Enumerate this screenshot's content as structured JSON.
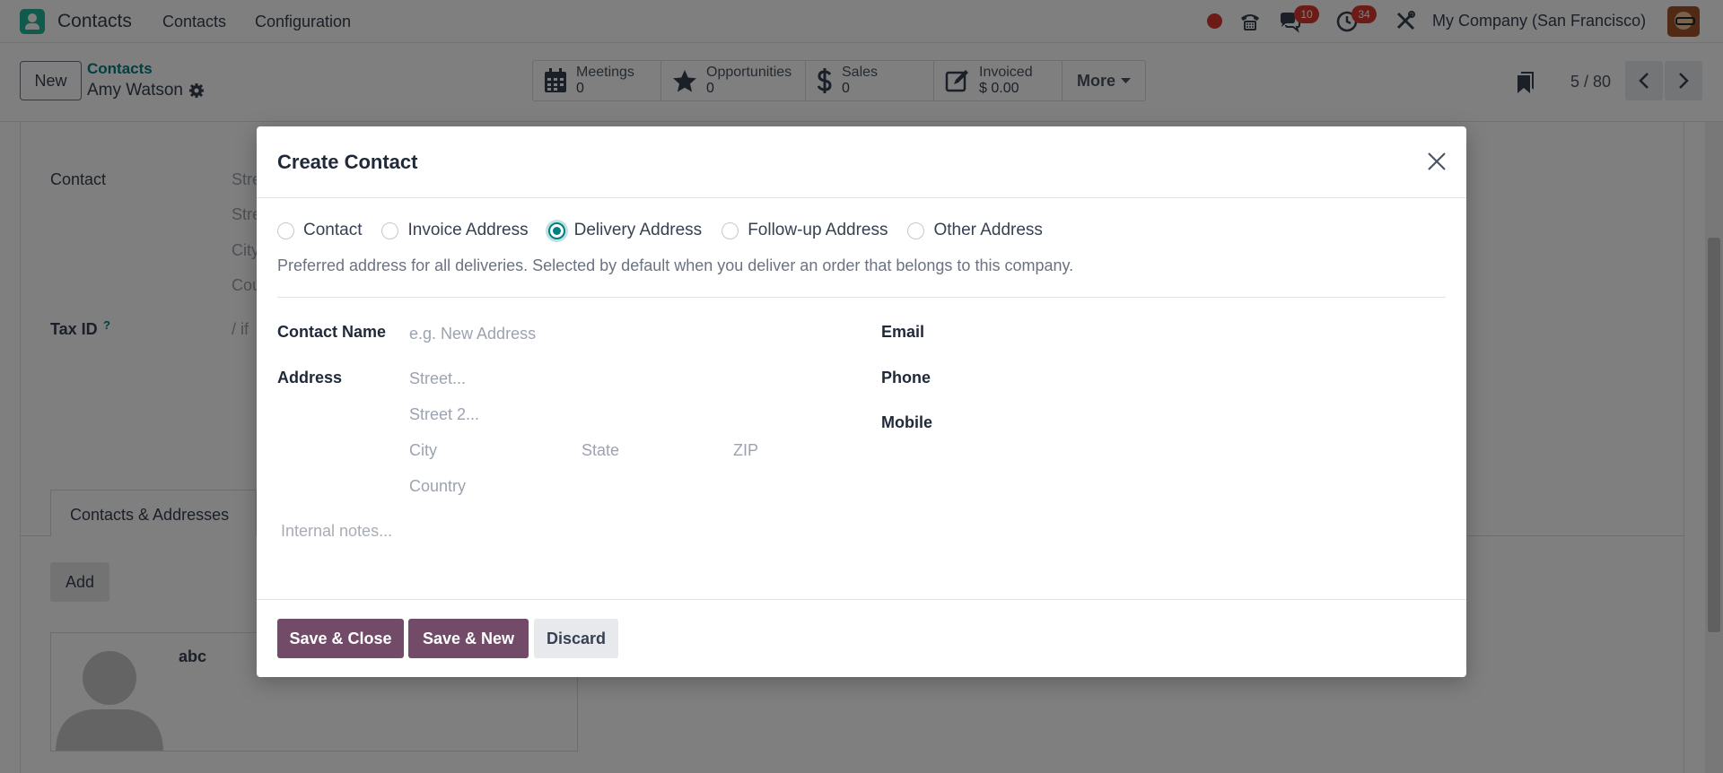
{
  "navbar": {
    "app_name": "Contacts",
    "menu": [
      "Contacts",
      "Configuration"
    ],
    "chat_badge": "10",
    "activity_badge": "34",
    "company": "My Company (San Francisco)"
  },
  "control_panel": {
    "new_label": "New",
    "breadcrumb_parent": "Contacts",
    "record_name": "Amy Watson",
    "smart_buttons": [
      {
        "label": "Meetings",
        "value": "0",
        "icon": "calendar-icon"
      },
      {
        "label": "Opportunities",
        "value": "0",
        "icon": "star-icon"
      },
      {
        "label": "Sales",
        "value": "0",
        "icon": "dollar-icon"
      },
      {
        "label": "Invoiced",
        "value": "$ 0.00",
        "icon": "invoice-icon"
      }
    ],
    "more_label": "More",
    "pager": "5 / 80"
  },
  "background_form": {
    "contact_label": "Contact",
    "street_ph": "Stre",
    "street2_ph": "Stre",
    "city_ph": "City",
    "country_ph": "Cou",
    "taxid_label": "Tax ID",
    "taxid_help": "?",
    "taxid_ph": "/ if",
    "tab_label": "Contacts & Addresses",
    "add_label": "Add",
    "card_name": "abc"
  },
  "modal": {
    "title": "Create Contact",
    "types": [
      {
        "label": "Contact",
        "selected": false
      },
      {
        "label": "Invoice Address",
        "selected": false
      },
      {
        "label": "Delivery Address",
        "selected": true
      },
      {
        "label": "Follow-up Address",
        "selected": false
      },
      {
        "label": "Other Address",
        "selected": false
      }
    ],
    "help_text": "Preferred address for all deliveries. Selected by default when you deliver an order that belongs to this company.",
    "contact_name_label": "Contact Name",
    "contact_name_ph": "e.g. New Address",
    "address_label": "Address",
    "street_ph": "Street...",
    "street2_ph": "Street 2...",
    "city_ph": "City",
    "state_ph": "State",
    "zip_ph": "ZIP",
    "country_ph": "Country",
    "email_label": "Email",
    "phone_label": "Phone",
    "mobile_label": "Mobile",
    "notes_ph": "Internal notes...",
    "save_close_label": "Save & Close",
    "save_new_label": "Save & New",
    "discard_label": "Discard"
  },
  "colors": {
    "primary": "#714b67",
    "accent": "#017e84",
    "badge": "#d9372e"
  }
}
